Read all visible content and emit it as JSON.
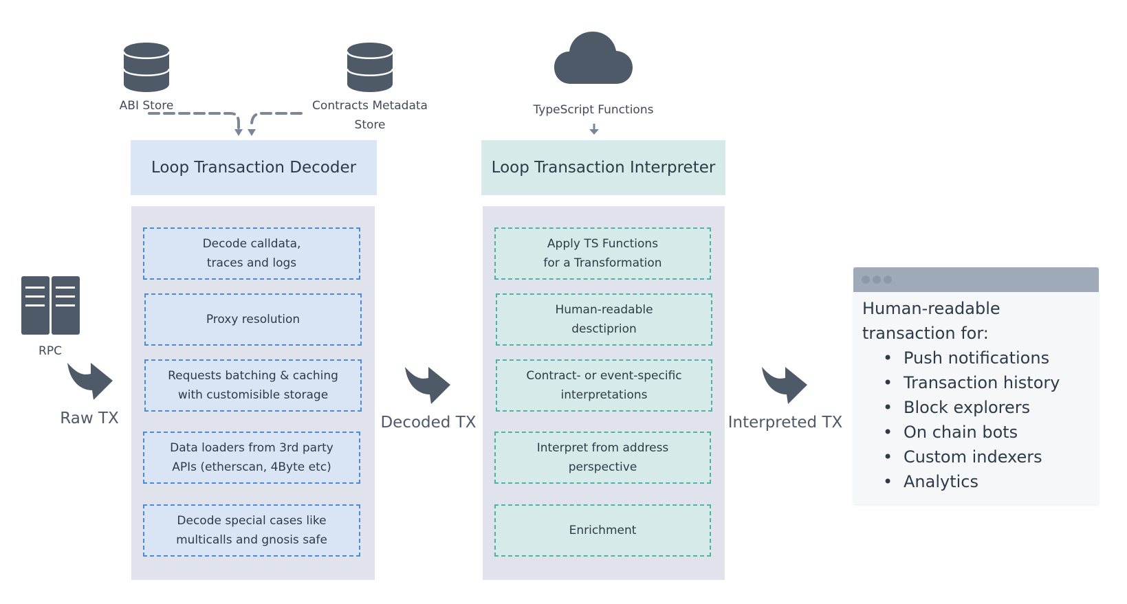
{
  "sources": {
    "abi_store": {
      "icon": "database-icon",
      "label": "ABI Store"
    },
    "contracts_metadata_store": {
      "icon": "database-icon",
      "label": "Contracts Metadata\nStore"
    },
    "typescript_functions": {
      "icon": "cloud-icon",
      "label": "TypeScript Functions"
    },
    "rpc": {
      "icon": "server-icon",
      "label": "RPC"
    }
  },
  "flow_labels": {
    "raw_tx": "Raw TX",
    "decoded_tx": "Decoded TX",
    "interpreted_tx": "Interpreted TX"
  },
  "decoder": {
    "title": "Loop Transaction Decoder",
    "steps": [
      "Decode calldata,\ntraces and logs",
      "Proxy resolution",
      "Requests batching & caching\nwith customisible storage",
      "Data loaders from 3rd party\nAPIs (etherscan, 4Byte etc)",
      "Decode special cases like\nmulticalls and gnosis safe"
    ]
  },
  "interpreter": {
    "title": "Loop Transaction Interpreter",
    "steps": [
      "Apply TS Functions\nfor a Transformation",
      "Human-readable\ndesctiprion",
      "Contract- or event-specific\ninterpretations",
      "Interpret from address\nperspective",
      "Enrichment"
    ]
  },
  "output": {
    "intro": "Human-readable transaction for:",
    "items": [
      "Push notifications",
      "Transaction history",
      "Block explorers",
      "On chain bots",
      "Custom indexers",
      "Analytics"
    ]
  },
  "colors": {
    "icon": "#4e5a68",
    "decoder_header": "#dae6f5",
    "interpreter_header": "#d6ebe9",
    "panel": "#e0e3ec",
    "decoder_border": "#4a8ad6",
    "interpreter_border": "#4fb3a3",
    "connector": "#7a8794"
  }
}
